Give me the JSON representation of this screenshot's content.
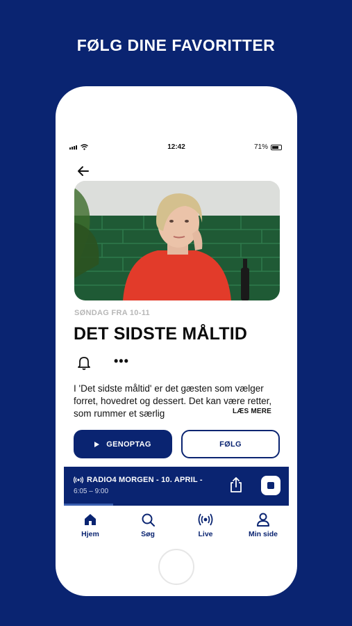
{
  "headline": "FØLG DINE FAVORITTER",
  "status_bar": {
    "time": "12:42",
    "battery": "71%",
    "battery_level": 0.71
  },
  "program": {
    "schedule": "SØNDAG FRA 10-11",
    "title": "DET SIDSTE MÅLTID",
    "description": "I 'Det sidste måltid' er det gæsten som vælger forret, hovedret og dessert. Det kan være retter, som rummer et særlig",
    "read_more": "LÆS MERE",
    "resume_label": "GENOPTAG",
    "follow_label": "FØLG"
  },
  "player": {
    "show": "RADIO4 MORGEN - 10. APRIL -",
    "hours": "6:05 – 9:00",
    "progress": 0.22
  },
  "tabs": [
    {
      "label": "Hjem",
      "icon": "home-icon"
    },
    {
      "label": "Søg",
      "icon": "search-icon"
    },
    {
      "label": "Live",
      "icon": "broadcast-icon"
    },
    {
      "label": "Min side",
      "icon": "person-icon"
    }
  ],
  "colors": {
    "brand": "#0a2471",
    "background": "#0a2471",
    "hero_shirt": "#e23b2a",
    "hero_tiles": "#1f5a35"
  }
}
